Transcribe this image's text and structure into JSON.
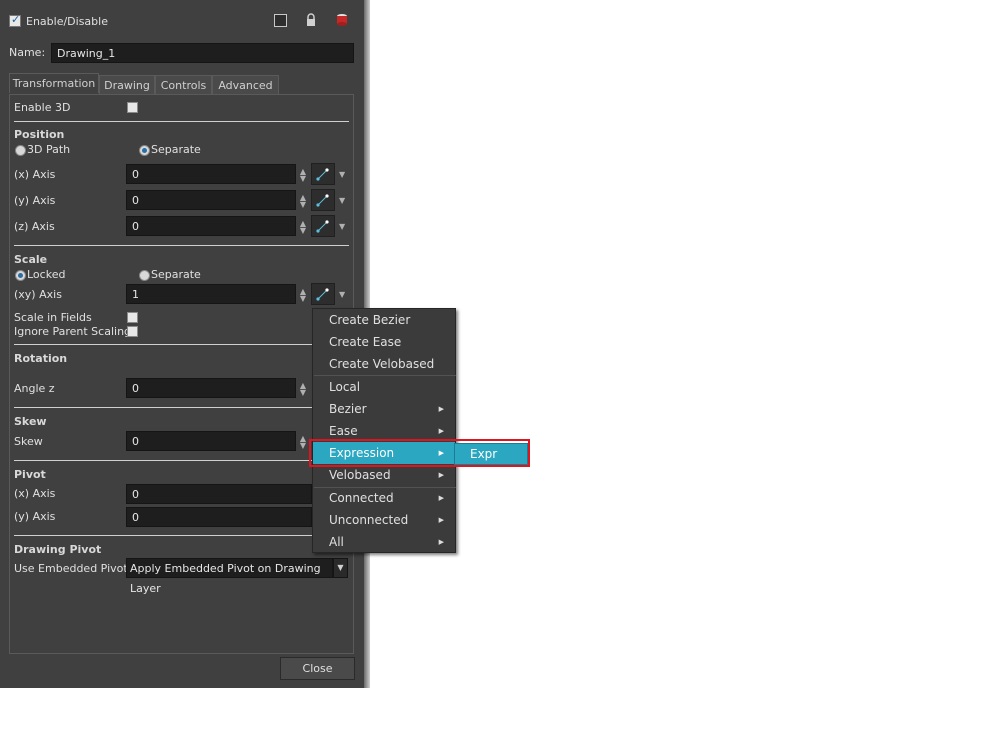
{
  "header": {
    "enable_label": "Enable/Disable"
  },
  "name": {
    "label": "Name:",
    "value": "Drawing_1"
  },
  "tabs": [
    {
      "label": "Transformation",
      "active": true
    },
    {
      "label": "Drawing"
    },
    {
      "label": "Controls"
    },
    {
      "label": "Advanced"
    }
  ],
  "enable3d": {
    "label": "Enable 3D"
  },
  "position": {
    "title": "Position",
    "radio_3d": "3D Path",
    "radio_sep": "Separate",
    "x_label": "(x) Axis",
    "x_value": "0",
    "y_label": "(y) Axis",
    "y_value": "0",
    "z_label": "(z) Axis",
    "z_value": "0"
  },
  "scale": {
    "title": "Scale",
    "radio_locked": "Locked",
    "radio_sep": "Separate",
    "xy_label": "(xy) Axis",
    "xy_value": "1",
    "in_fields": "Scale in Fields",
    "ignore_parent": "Ignore Parent Scaling"
  },
  "rotation": {
    "title": "Rotation",
    "label": "Angle z",
    "value": "0"
  },
  "skew": {
    "title": "Skew",
    "label": "Skew",
    "value": "0"
  },
  "pivot": {
    "title": "Pivot",
    "x_label": "(x) Axis",
    "x_value": "0",
    "y_label": "(y) Axis",
    "y_value": "0"
  },
  "drawing_pivot": {
    "title": "Drawing Pivot",
    "label": "Use Embedded Pivots",
    "value": "Apply Embedded Pivot on Drawing Layer"
  },
  "close_label": "Close",
  "context_menu": {
    "items": [
      "Create Bezier",
      "Create Ease",
      "Create Velobased",
      "Local",
      "Bezier",
      "Ease",
      "Expression",
      "Velobased",
      "Connected",
      "Unconnected",
      "All"
    ],
    "submenu": "Expr"
  },
  "colors": {
    "highlight": "#2ba7c1",
    "annotation": "#e0141f",
    "panel": "#404040"
  }
}
